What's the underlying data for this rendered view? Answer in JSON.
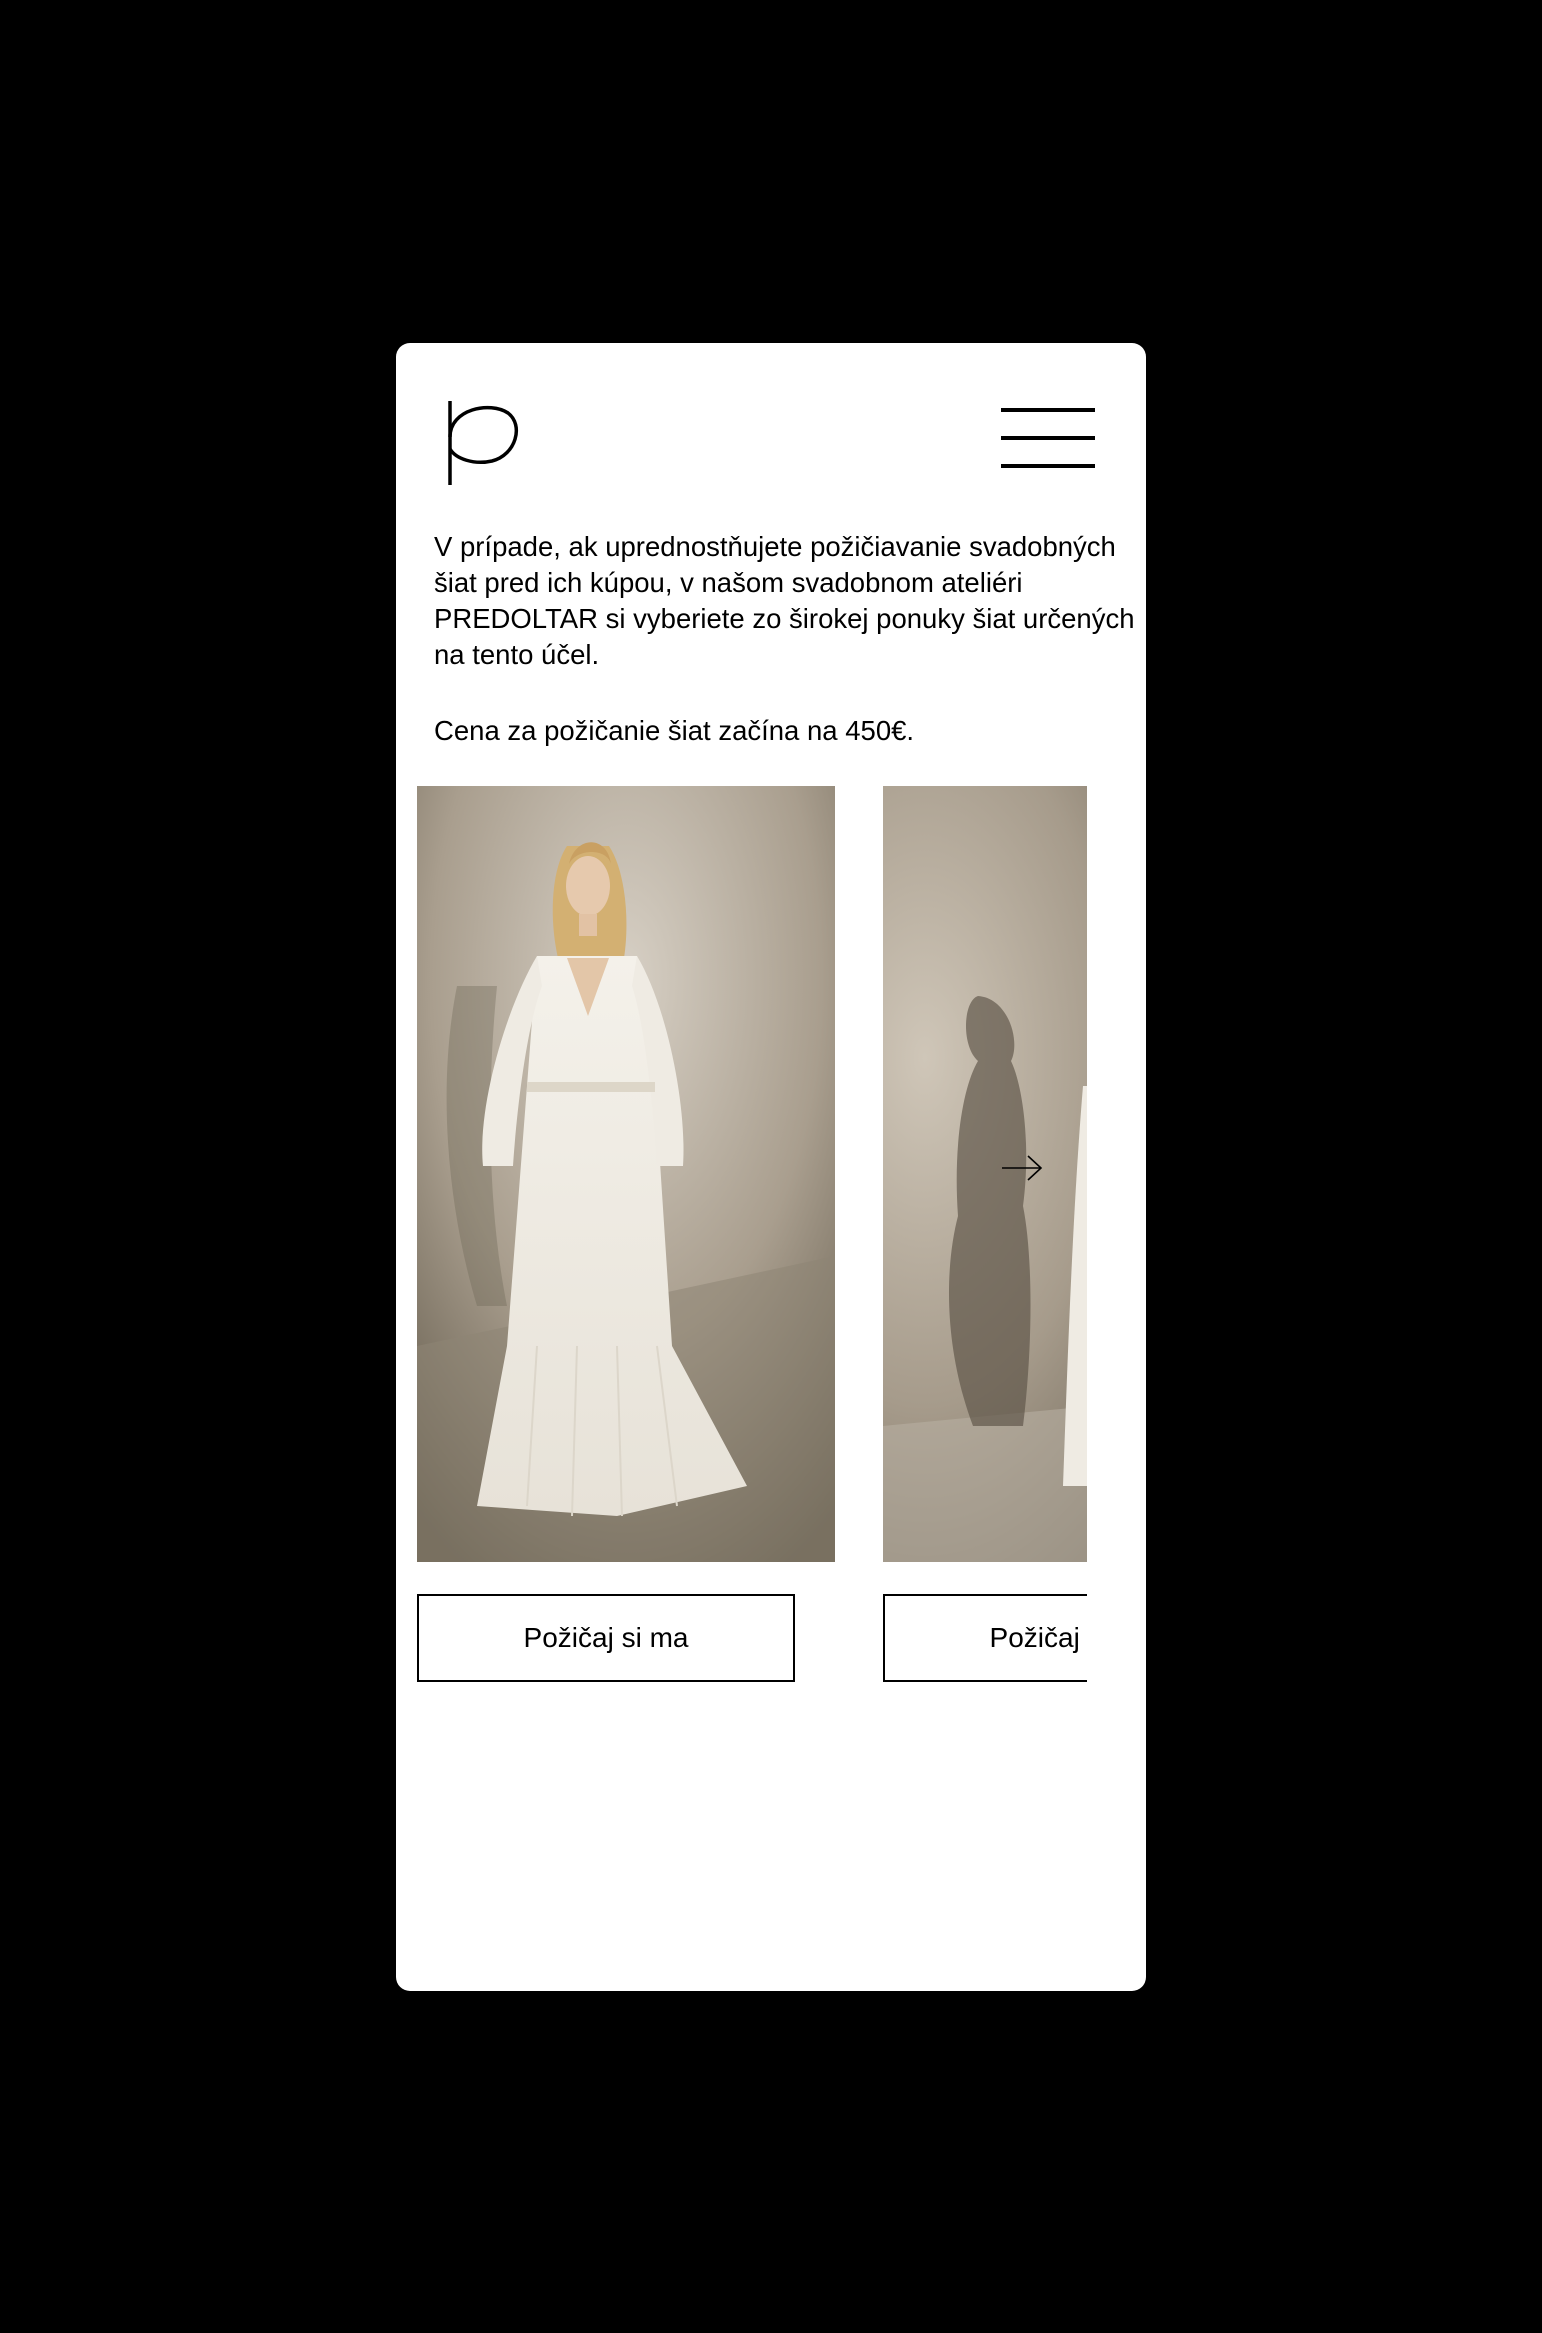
{
  "header": {
    "logo_icon": "predoltar-p-logo",
    "menu_icon": "hamburger-icon"
  },
  "content": {
    "intro_text": "V prípade, ak uprednostňujete požičiavanie svadobných šiat pred ich kúpou, v našom svadobnom ateliéri PREDOLTAR si vyberiete zo širokej ponuky šiat určených na tento účel.",
    "price_text": "Cena za požičanie šiat začína na 450€."
  },
  "carousel": {
    "slides": [
      {
        "button_label": "Požičaj si ma"
      },
      {
        "button_label": "Požičaj si ma"
      }
    ],
    "next_icon": "arrow-right-icon"
  },
  "colors": {
    "background": "#000000",
    "screen": "#ffffff",
    "text": "#000000"
  }
}
